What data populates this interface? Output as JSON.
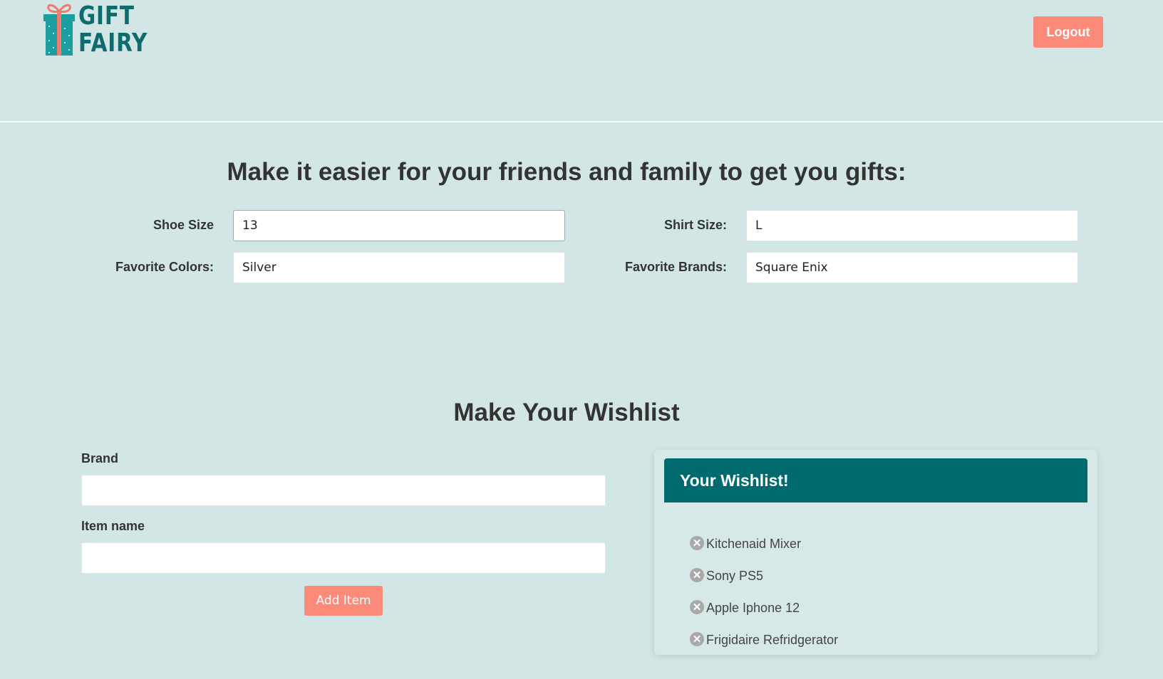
{
  "header": {
    "logo_line1": "GIFT",
    "logo_line2": "FAIRY",
    "logout_label": "Logout"
  },
  "sizes_section": {
    "title": "Make it easier for your friends and family to get you gifts:",
    "shoe_size": {
      "label": "Shoe Size",
      "value": "13"
    },
    "shirt_size": {
      "label": "Shirt Size:",
      "value": "L"
    },
    "favorite_colors": {
      "label": "Favorite Colors:",
      "value": "Silver"
    },
    "favorite_brands": {
      "label": "Favorite Brands:",
      "value": "Square Enix"
    }
  },
  "wishlist_form": {
    "title": "Make Your Wishlist",
    "brand_label": "Brand",
    "brand_value": "",
    "item_label": "Item name",
    "item_value": "",
    "add_label": "Add Item"
  },
  "wishlist_card": {
    "title": "Your Wishlist!",
    "items": [
      {
        "label": "Kitchenaid Mixer"
      },
      {
        "label": "Sony PS5"
      },
      {
        "label": "Apple Iphone 12"
      },
      {
        "label": "Frigidaire Refridgerator"
      }
    ],
    "remove_icon": "close-circle-icon"
  },
  "colors": {
    "background": "#d2e7e5",
    "accent": "#fb8a78",
    "brand_teal": "#006a6e"
  }
}
